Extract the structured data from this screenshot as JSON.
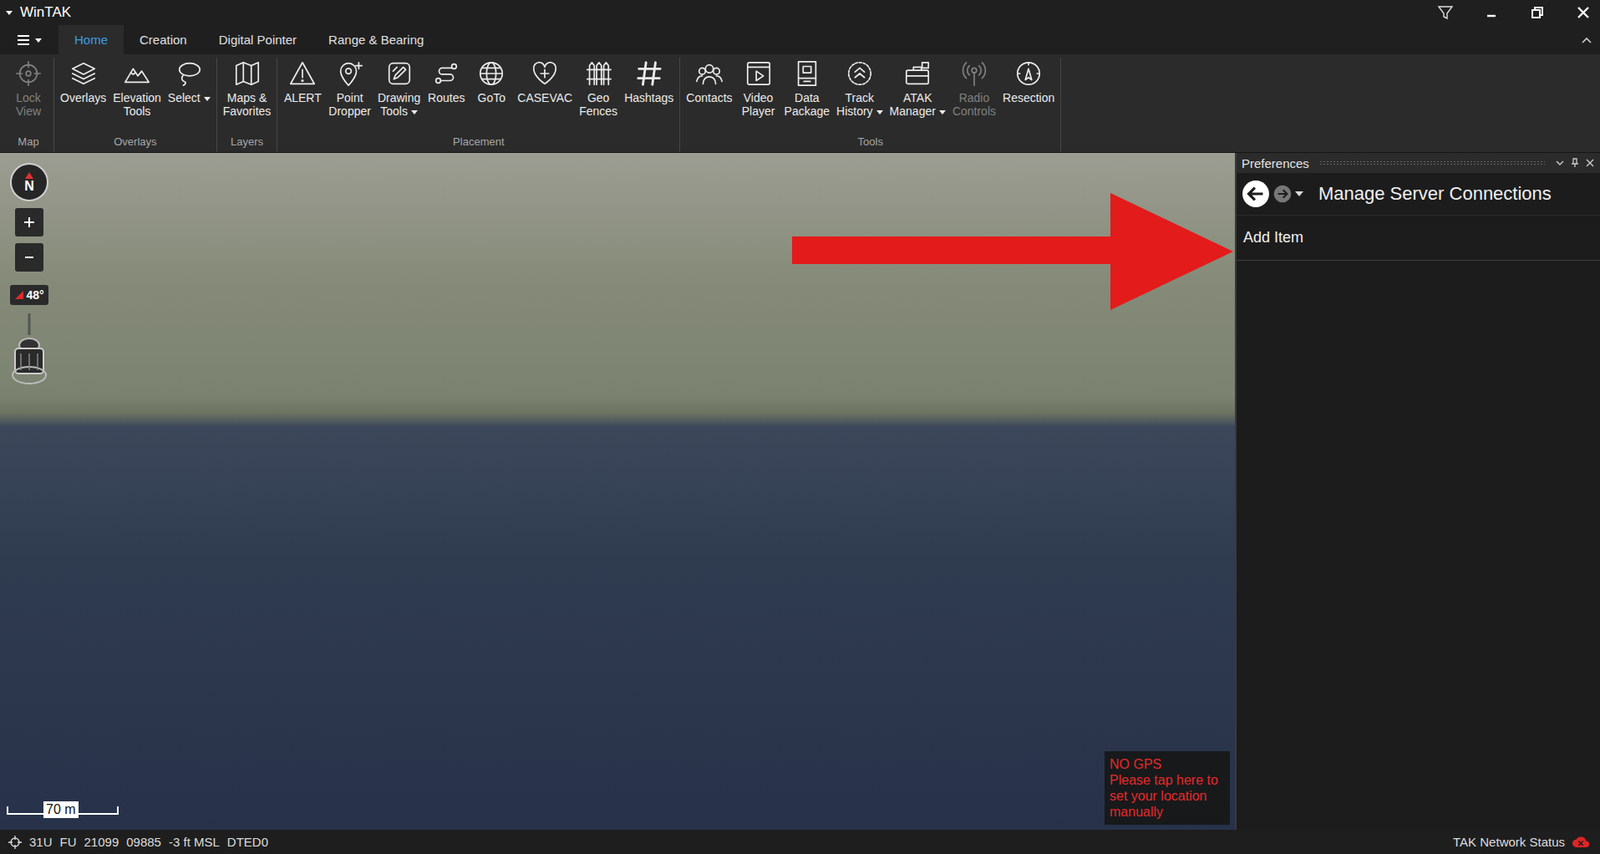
{
  "window": {
    "title": "WinTAK"
  },
  "tabs": [
    {
      "label": "Home",
      "selected": true
    },
    {
      "label": "Creation",
      "selected": false
    },
    {
      "label": "Digital Pointer",
      "selected": false
    },
    {
      "label": "Range & Bearing",
      "selected": false
    }
  ],
  "ribbon": {
    "groups": [
      {
        "label": "Map",
        "items": [
          {
            "lines": [
              "Lock",
              "View"
            ],
            "disabled": true,
            "dropdown": false
          }
        ]
      },
      {
        "label": "Overlays",
        "items": [
          {
            "lines": [
              "Overlays"
            ],
            "disabled": false,
            "dropdown": false
          },
          {
            "lines": [
              "Elevation",
              "Tools"
            ],
            "disabled": false,
            "dropdown": false
          },
          {
            "lines": [
              "Select"
            ],
            "disabled": false,
            "dropdown": true
          }
        ]
      },
      {
        "label": "Layers",
        "items": [
          {
            "lines": [
              "Maps &",
              "Favorites"
            ],
            "disabled": false,
            "dropdown": false
          }
        ]
      },
      {
        "label": "Placement",
        "items": [
          {
            "lines": [
              "ALERT"
            ],
            "disabled": false,
            "dropdown": false
          },
          {
            "lines": [
              "Point",
              "Dropper"
            ],
            "disabled": false,
            "dropdown": false
          },
          {
            "lines": [
              "Drawing",
              "Tools"
            ],
            "disabled": false,
            "dropdown": true
          },
          {
            "lines": [
              "Routes"
            ],
            "disabled": false,
            "dropdown": false
          },
          {
            "lines": [
              "GoTo"
            ],
            "disabled": false,
            "dropdown": false
          },
          {
            "lines": [
              "CASEVAC"
            ],
            "disabled": false,
            "dropdown": false
          },
          {
            "lines": [
              "Geo",
              "Fences"
            ],
            "disabled": false,
            "dropdown": false
          },
          {
            "lines": [
              "Hashtags"
            ],
            "disabled": false,
            "dropdown": false
          }
        ]
      },
      {
        "label": "Tools",
        "items": [
          {
            "lines": [
              "Contacts"
            ],
            "disabled": false,
            "dropdown": false
          },
          {
            "lines": [
              "Video",
              "Player"
            ],
            "disabled": false,
            "dropdown": false
          },
          {
            "lines": [
              "Data",
              "Package"
            ],
            "disabled": false,
            "dropdown": false
          },
          {
            "lines": [
              "Track",
              "History"
            ],
            "disabled": false,
            "dropdown": true
          },
          {
            "lines": [
              "ATAK",
              "Manager"
            ],
            "disabled": false,
            "dropdown": true
          },
          {
            "lines": [
              "Radio",
              "Controls"
            ],
            "disabled": true,
            "dropdown": false
          },
          {
            "lines": [
              "Resection"
            ],
            "disabled": false,
            "dropdown": false
          }
        ]
      }
    ]
  },
  "map": {
    "compass": "N",
    "tilt": "48°",
    "scale": "70 m",
    "gps_warning": {
      "title": "NO GPS",
      "message": "Please tap here to set your location manually"
    }
  },
  "panel": {
    "title": "Preferences",
    "page_title": "Manage Server Connections",
    "back_disabled": false,
    "forward_disabled": true,
    "items": [
      {
        "label": "Add Item"
      }
    ]
  },
  "status_bar": {
    "coordinates": [
      "31U",
      "FU",
      "21099",
      "09885",
      "-3 ft MSL",
      "DTED0"
    ],
    "network": {
      "label": "TAK Network Status",
      "connected": false
    }
  }
}
